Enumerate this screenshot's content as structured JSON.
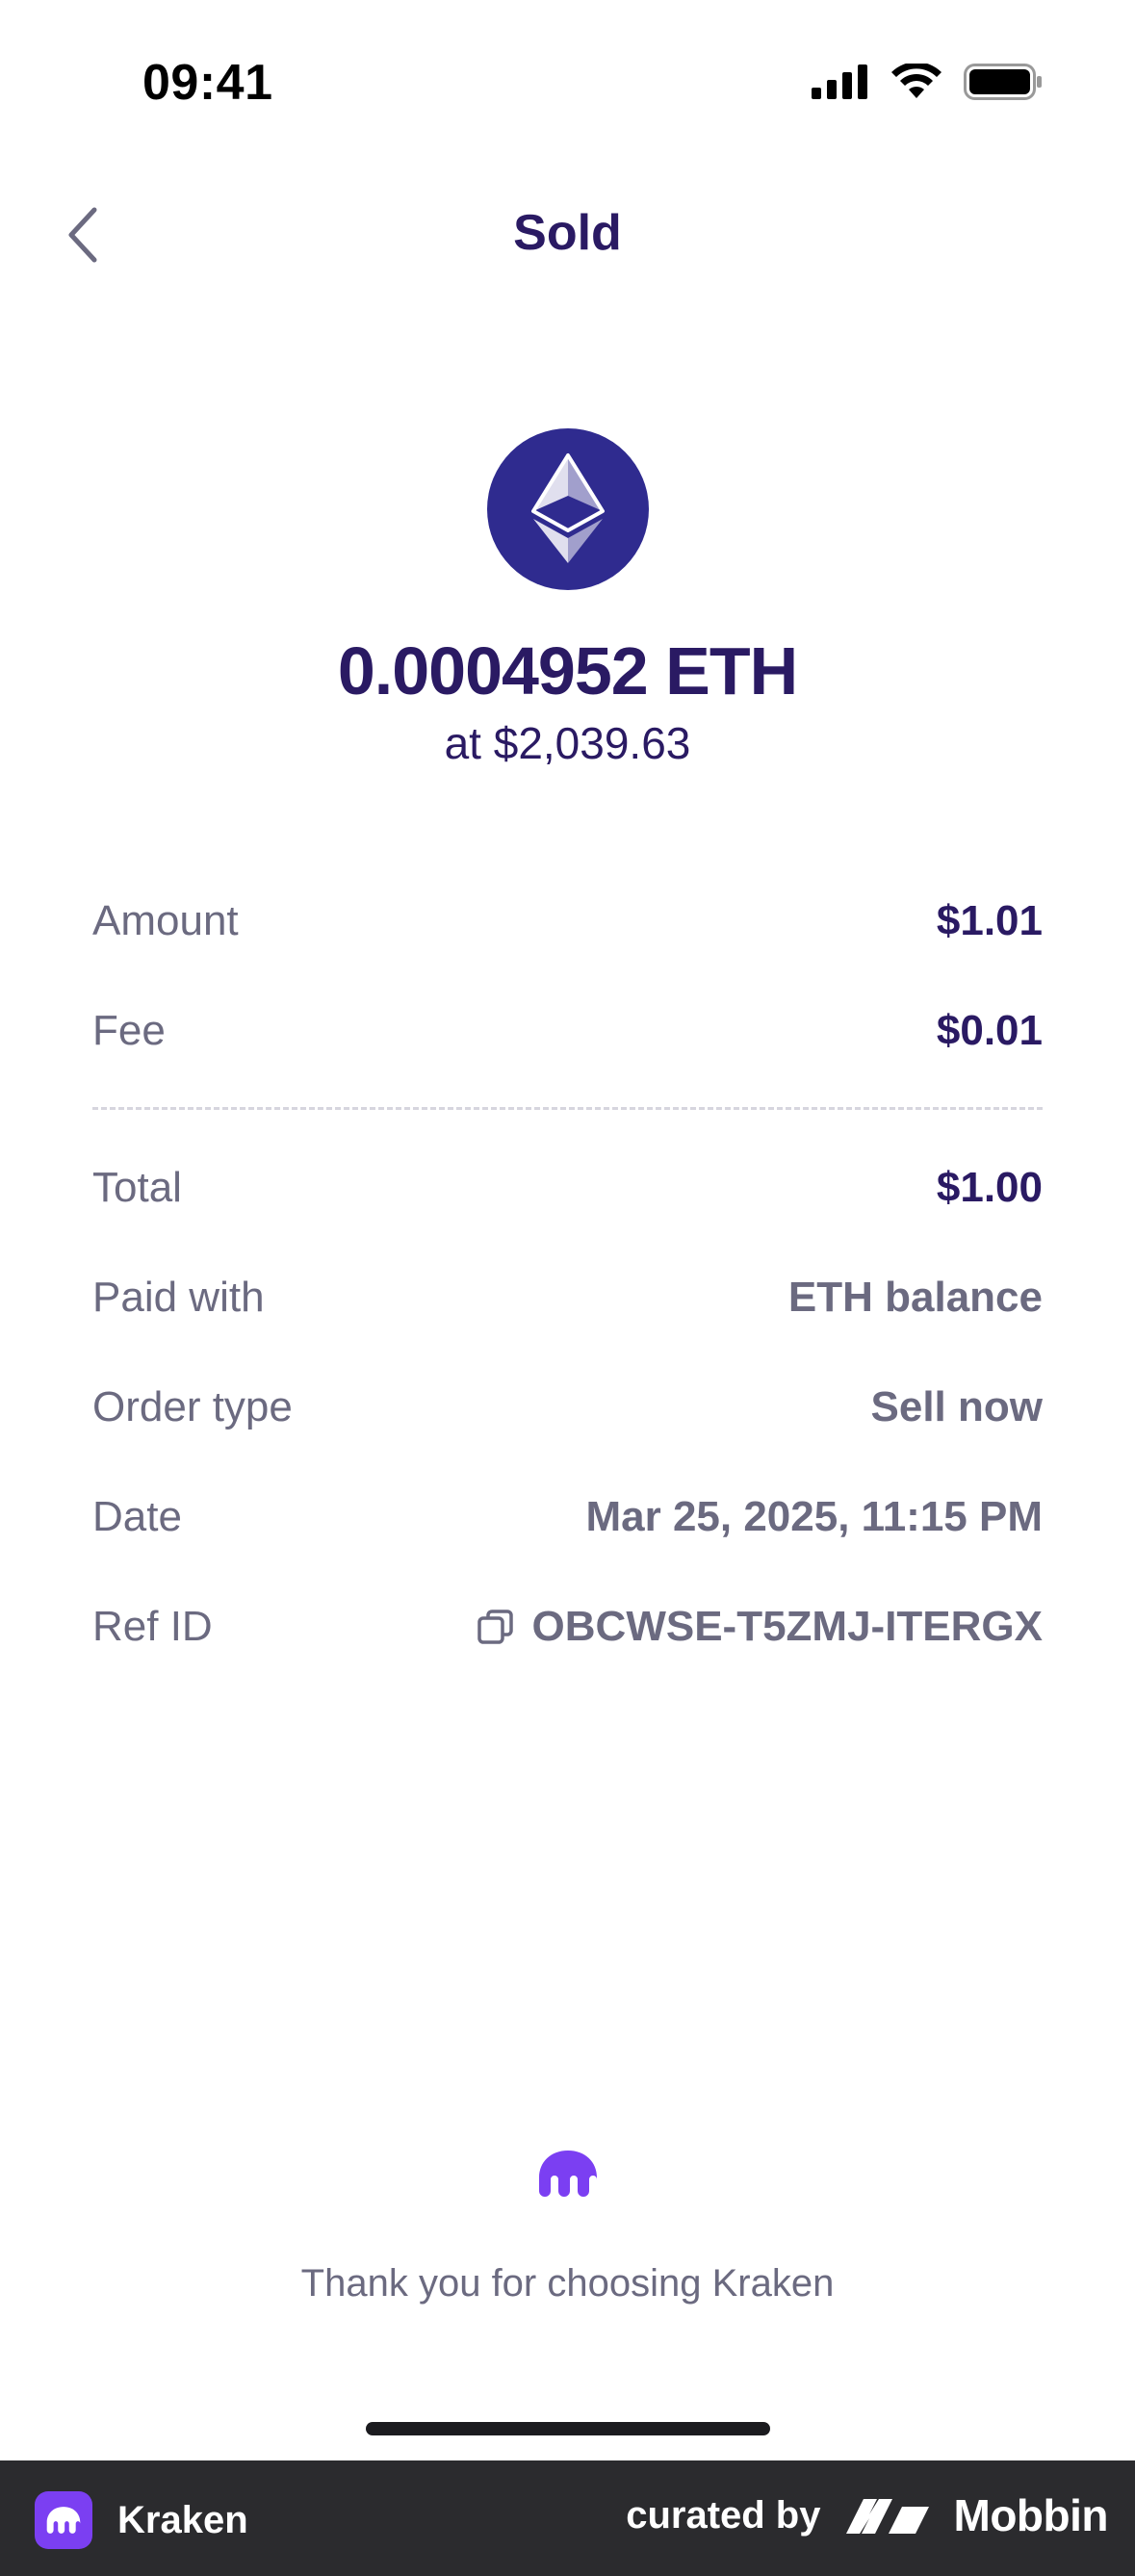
{
  "status_bar": {
    "time": "09:41"
  },
  "nav": {
    "title": "Sold"
  },
  "hero": {
    "icon": "ethereum-icon",
    "amount": "0.0004952 ETH",
    "price": "at $2,039.63"
  },
  "details": {
    "amount": {
      "label": "Amount",
      "value": "$1.01"
    },
    "fee": {
      "label": "Fee",
      "value": "$0.01"
    },
    "total": {
      "label": "Total",
      "value": "$1.00"
    },
    "paid_with": {
      "label": "Paid with",
      "value": "ETH balance"
    },
    "order_type": {
      "label": "Order type",
      "value": "Sell now"
    },
    "date": {
      "label": "Date",
      "value": "Mar 25, 2025, 11:15 PM"
    },
    "ref_id": {
      "label": "Ref ID",
      "value": "OBCWSE-T5ZMJ-ITERGX"
    }
  },
  "footer": {
    "thanks": "Thank you for choosing Kraken"
  },
  "brand_bar": {
    "app_name": "Kraken",
    "curated_by": "curated by",
    "mobbin": "Mobbin"
  },
  "colors": {
    "primary_text": "#2a1a63",
    "secondary_text": "#6b6a80",
    "eth_circle": "#2f2b8f",
    "kraken_purple": "#7b3ff2",
    "brand_bar_bg": "#2b2b2e"
  }
}
